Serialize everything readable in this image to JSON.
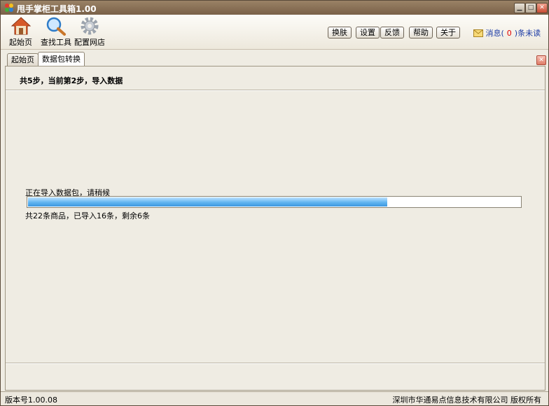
{
  "window": {
    "title": "甩手掌柜工具箱1.00"
  },
  "toolbar": {
    "tools": [
      {
        "label": "起始页",
        "icon": "home-icon"
      },
      {
        "label": "查找工具",
        "icon": "search-icon"
      },
      {
        "label": "配置网店",
        "icon": "gear-icon"
      }
    ],
    "buttons": [
      "换肤",
      "设置",
      "反馈",
      "帮助",
      "关于"
    ],
    "messages": {
      "prefix": "消息(",
      "count": "0",
      "suffix": ")条未读",
      "icon": "envelope-icon"
    }
  },
  "tabs": [
    {
      "label": "起始页",
      "active": false
    },
    {
      "label": "数据包转换",
      "active": true
    }
  ],
  "main": {
    "step_text": "共5步，当前第2步，导入数据",
    "import_status": "正在导入数据包，请稍候",
    "progress": 0.73,
    "count_text": "共22条商品，已导入16条，剩余6条"
  },
  "status": {
    "version": "版本号1.00.08",
    "copyright": "深圳市华通易点信息技术有限公司 版权所有"
  },
  "colors": {
    "titlebar": "#8a7258",
    "progress": "#3d98e0",
    "unread": "#e00000",
    "link": "#1b3aa5"
  }
}
